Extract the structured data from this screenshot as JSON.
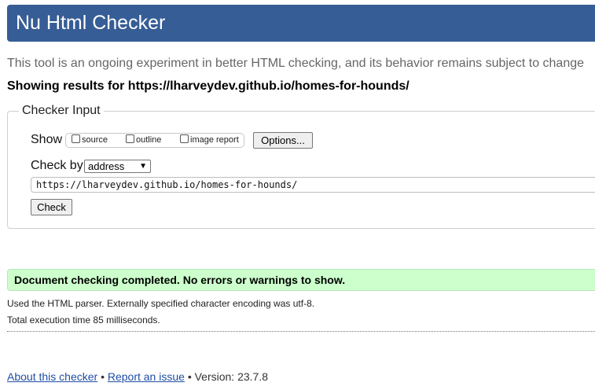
{
  "header": {
    "title": "Nu Html Checker"
  },
  "intro": {
    "text": "This tool is an ongoing experiment in better HTML checking, and its behavior remains subject to change"
  },
  "showing": {
    "text": "Showing results for https://lharveydev.github.io/homes-for-hounds/"
  },
  "checker_input": {
    "legend": "Checker Input",
    "show_label": "Show",
    "options": [
      {
        "label": "source",
        "checked": false
      },
      {
        "label": "outline",
        "checked": false
      },
      {
        "label": "image report",
        "checked": false
      }
    ],
    "options_button": "Options...",
    "check_by_label": "Check by",
    "check_by_value": "address",
    "url_value": "https://lharveydev.github.io/homes-for-hounds/",
    "check_button": "Check"
  },
  "result": {
    "success_message": "Document checking completed. No errors or warnings to show.",
    "parser_info": "Used the HTML parser. Externally specified character encoding was utf-8.",
    "execution_time": "Total execution time 85 milliseconds."
  },
  "footer": {
    "about_link": "About this checker",
    "separator": "•",
    "report_link": "Report an issue",
    "version": "Version: 23.7.8"
  },
  "colors": {
    "header_bg": "#365d95",
    "success_bg": "#ccffcc",
    "link": "#1f4ea3"
  }
}
